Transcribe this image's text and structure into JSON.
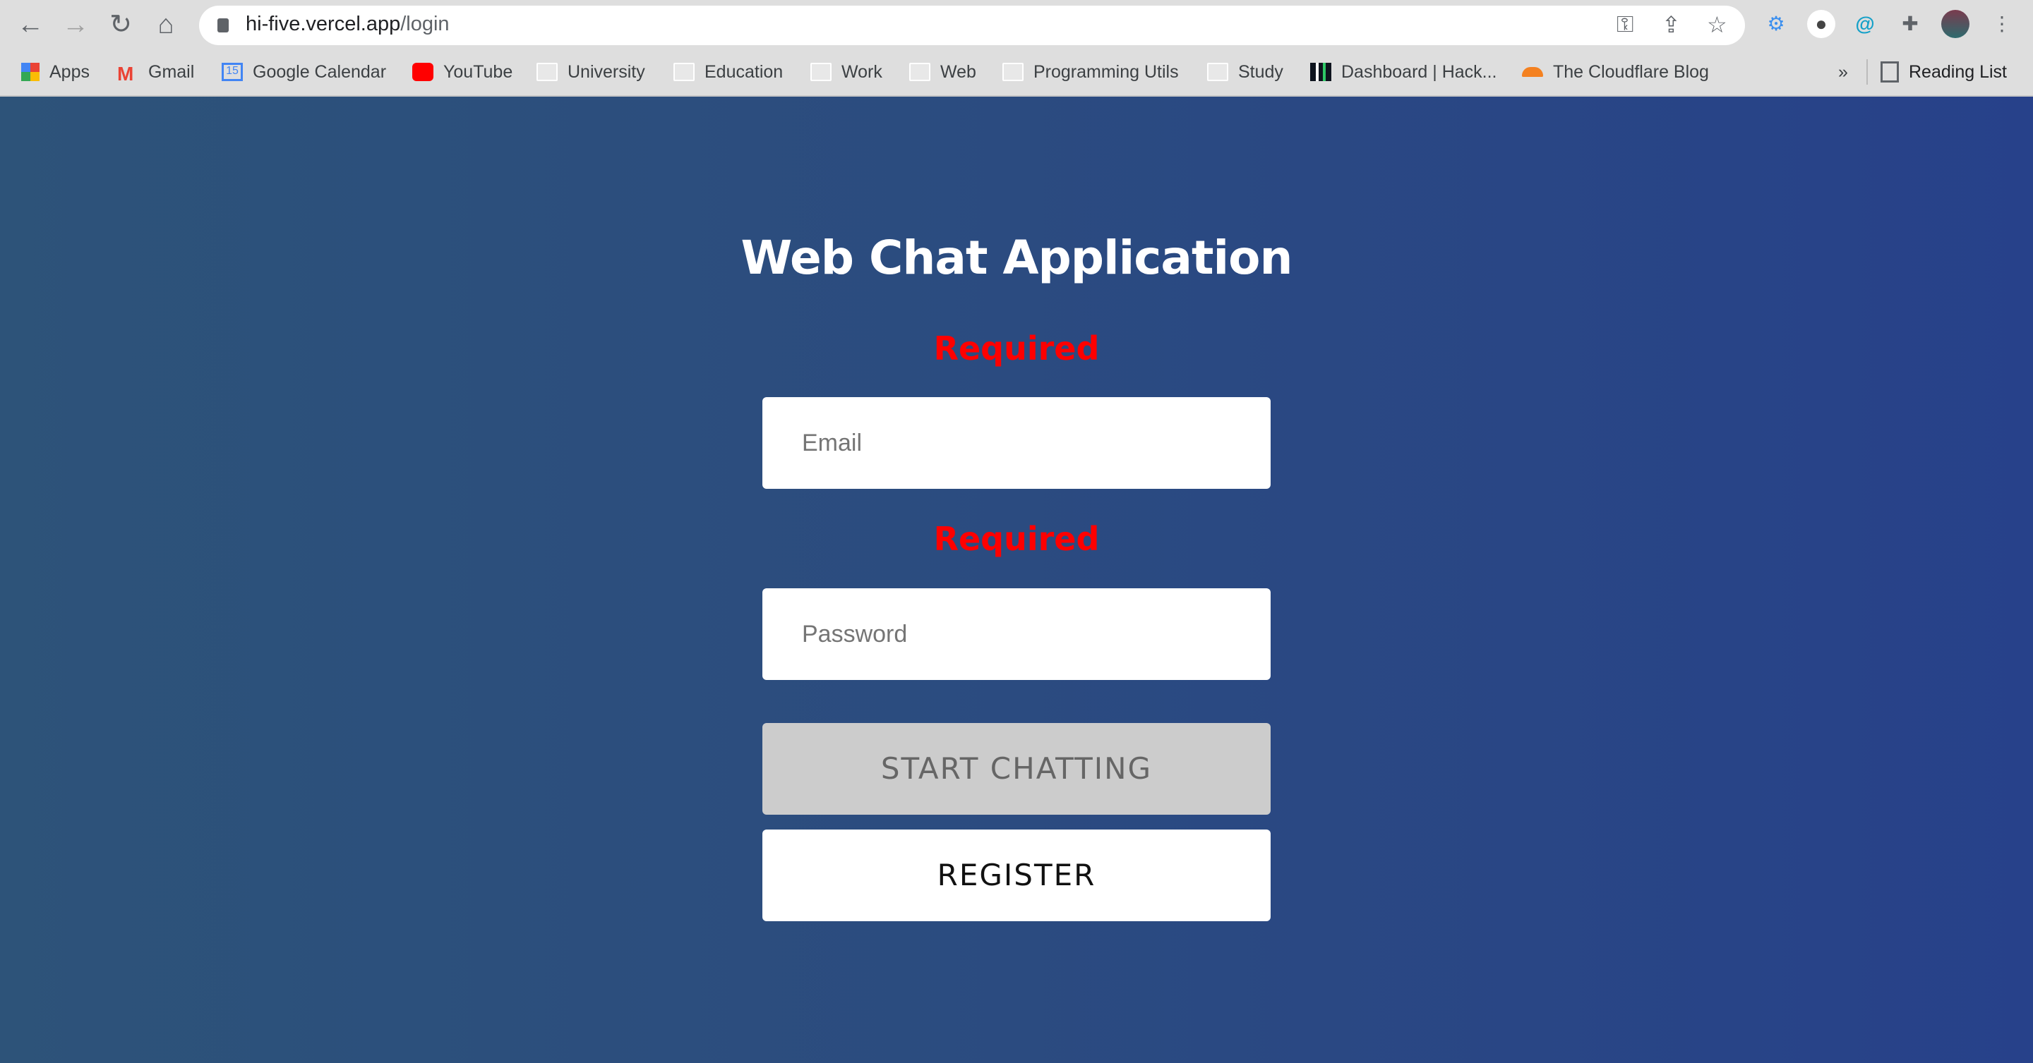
{
  "browser": {
    "url_host": "hi-five.vercel.app",
    "url_path": "/login",
    "bookmarks": [
      {
        "label": "Apps",
        "icon": "apps-grid-icon"
      },
      {
        "label": "Gmail",
        "icon": "gmail-icon"
      },
      {
        "label": "Google Calendar",
        "icon": "calendar-icon"
      },
      {
        "label": "YouTube",
        "icon": "youtube-icon"
      },
      {
        "label": "University",
        "icon": "folder-icon"
      },
      {
        "label": "Education",
        "icon": "folder-icon"
      },
      {
        "label": "Work",
        "icon": "folder-icon"
      },
      {
        "label": "Web",
        "icon": "folder-icon"
      },
      {
        "label": "Programming Utils",
        "icon": "folder-icon"
      },
      {
        "label": "Study",
        "icon": "folder-icon"
      },
      {
        "label": "Dashboard | Hack...",
        "icon": "hackerrank-icon"
      },
      {
        "label": "The Cloudflare Blog",
        "icon": "cloudflare-icon"
      }
    ],
    "overflow": "»",
    "reading_list": "Reading List",
    "calendar_day": "15"
  },
  "page": {
    "title": "Web Chat Application",
    "email_error": "Required",
    "email_placeholder": "Email",
    "password_error": "Required",
    "password_placeholder": "Password",
    "start_label": "START CHATTING",
    "register_label": "REGISTER"
  },
  "colors": {
    "error": "#ff0000",
    "background_left": "#2d5379",
    "background_right": "#27418a",
    "disabled_button": "#cccccc"
  }
}
